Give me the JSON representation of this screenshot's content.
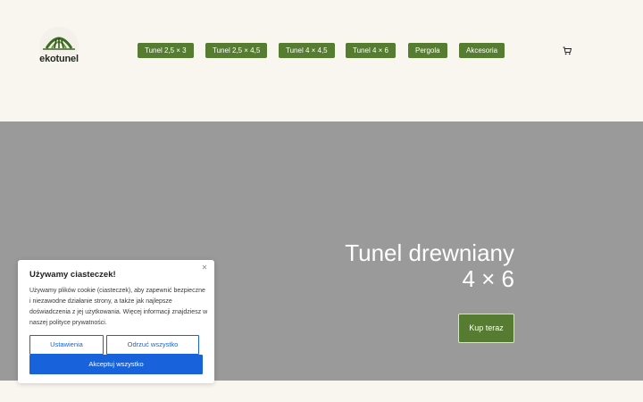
{
  "header": {
    "logo_text": "ekotunel",
    "nav": [
      {
        "label": "Tunel 2,5 × 3"
      },
      {
        "label": "Tunel 2,5 × 4,5"
      },
      {
        "label": "Tunel 4 × 4,5"
      },
      {
        "label": "Tunel 4 × 6"
      },
      {
        "label": "Pergola"
      },
      {
        "label": "Akcesoria"
      }
    ],
    "cart_icon": "cart-icon"
  },
  "hero": {
    "title_line1": "Tunel drewniany",
    "title_line2": "4 × 6",
    "cta_label": "Kup teraz"
  },
  "cookie": {
    "title": "Używamy ciasteczek!",
    "text": "Używamy plików cookie (ciasteczek), aby zapewnić bezpieczne i niezawodne działanie strony, a także jak najlepsze doświadczenia z jej użytkowania. Więcej informacji znajdziesz w naszej polityce prywatności.",
    "settings_label": "Ustawienia",
    "reject_label": "Odrzuć wszystko",
    "accept_label": "Akceptuj wszystko",
    "close_icon": "close-icon"
  },
  "colors": {
    "brand_green": "#557c30",
    "hero_gray": "#9a9a9a",
    "cookie_blue": "#1863dc",
    "page_bg": "#f9f6f0"
  }
}
